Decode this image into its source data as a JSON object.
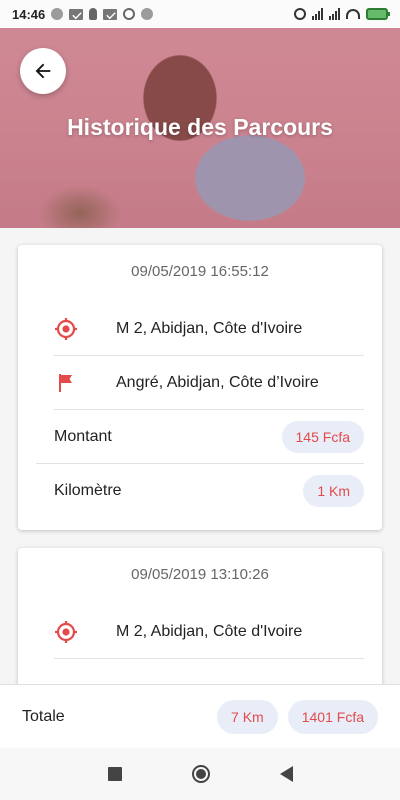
{
  "status_bar": {
    "time": "14:46"
  },
  "header": {
    "title": "Historique des Parcours"
  },
  "trips": [
    {
      "date": "09/05/2019 16:55:12",
      "start": "M 2, Abidjan, Côte d'Ivoire",
      "end": "Angré, Abidjan, Côte d’Ivoire",
      "amount_label": "Montant",
      "amount": "145 Fcfa",
      "distance_label": "Kilomètre",
      "distance": "1 Km"
    },
    {
      "date": "09/05/2019 13:10:26",
      "start": "M 2, Abidjan, Côte d'Ivoire"
    }
  ],
  "total": {
    "label": "Totale",
    "distance": "7 Km",
    "amount": "1401 Fcfa"
  },
  "colors": {
    "accent_red": "#e34b4b",
    "pill_bg": "#e8edf8"
  },
  "icons": {
    "start": "target-location-icon",
    "end": "flag-icon",
    "back": "arrow-left-icon"
  }
}
